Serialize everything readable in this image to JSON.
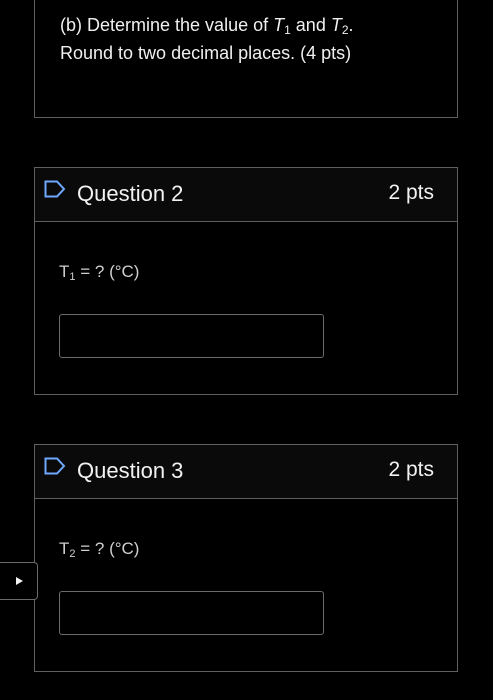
{
  "previous_part": {
    "line1_prefix": "(b) Determine the value of ",
    "t1_var": "T",
    "t1_sub": "1",
    "and_text": " and ",
    "t2_var": "T",
    "t2_sub": "2",
    "line1_suffix": ".",
    "line2": "Round to two decimal places. (4 pts)"
  },
  "questions": [
    {
      "title": "Question 2",
      "points": "2 pts",
      "prompt_var": "T",
      "prompt_sub": "1",
      "prompt_rest": " = ? (°C)",
      "answer_value": ""
    },
    {
      "title": "Question 3",
      "points": "2 pts",
      "prompt_var": "T",
      "prompt_sub": "2",
      "prompt_rest": " = ? (°C)",
      "answer_value": ""
    }
  ],
  "icons": {
    "flag": "flag-outline-icon",
    "side_toggle": "play-triangle-icon"
  },
  "colors": {
    "background": "#000000",
    "border": "#5f5f5f",
    "text": "#f2f2f2",
    "flag": "#6fa8ff"
  }
}
